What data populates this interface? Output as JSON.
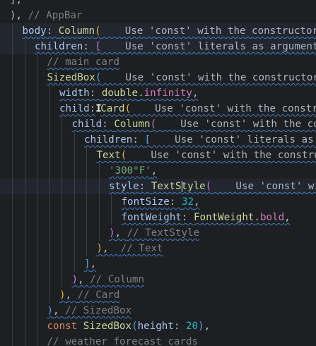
{
  "lines": [
    {
      "indent": 1,
      "hl": false,
      "wavy": false,
      "tokens": [
        [
          "],",
          "k-plain"
        ]
      ]
    },
    {
      "indent": 1,
      "hl": false,
      "wavy": false,
      "tokens": [
        [
          "), ",
          "k-plain"
        ],
        [
          "// AppBar",
          "k-cmt"
        ]
      ]
    },
    {
      "indent": 2,
      "hl": true,
      "wavy": true,
      "tokens": [
        [
          "body",
          "k-prop"
        ],
        [
          ": ",
          "k-plain"
        ],
        [
          "Column",
          "k-class"
        ],
        [
          "(",
          "b1"
        ],
        [
          "    Use 'const' with the constructor",
          "k-hint"
        ]
      ]
    },
    {
      "indent": 3,
      "hl": true,
      "wavy": true,
      "tokens": [
        [
          "children",
          "k-prop"
        ],
        [
          ": ",
          "k-plain"
        ],
        [
          "[",
          "b2"
        ],
        [
          "    Use 'const' literals as arguments",
          "k-hint"
        ]
      ]
    },
    {
      "indent": 4,
      "hl": false,
      "wavy": true,
      "tokens": [
        [
          "// main card",
          "k-cmt"
        ]
      ]
    },
    {
      "indent": 4,
      "hl": false,
      "wavy": true,
      "tokens": [
        [
          "SizedBox",
          "k-class"
        ],
        [
          "(",
          "b3"
        ],
        [
          "    Use 'const' with the constructor",
          "k-hint"
        ]
      ]
    },
    {
      "indent": 5,
      "hl": false,
      "wavy": true,
      "tokens": [
        [
          "width",
          "k-prop"
        ],
        [
          ": ",
          "k-plain"
        ],
        [
          "double",
          "k-class"
        ],
        [
          ".",
          "k-plain"
        ],
        [
          "infinity",
          "k-const"
        ],
        [
          ",",
          "k-plain"
        ]
      ]
    },
    {
      "indent": 5,
      "hl": false,
      "wavy": true,
      "tokens": [
        [
          "child",
          "k-prop"
        ],
        [
          ":",
          "k-plain"
        ],
        [
          "IBEAM",
          "k-plain"
        ],
        [
          "Card",
          "k-class"
        ],
        [
          "(",
          "b1"
        ],
        [
          "    Use 'const' with the constructor",
          "k-hint"
        ]
      ]
    },
    {
      "indent": 6,
      "hl": false,
      "wavy": true,
      "tokens": [
        [
          "child",
          "k-prop"
        ],
        [
          ": ",
          "k-plain"
        ],
        [
          "Column",
          "k-class"
        ],
        [
          "(",
          "b2"
        ],
        [
          "    Use 'const' with the constructor",
          "k-hint"
        ]
      ]
    },
    {
      "indent": 7,
      "hl": false,
      "wavy": true,
      "tokens": [
        [
          "children",
          "k-prop"
        ],
        [
          ": ",
          "k-plain"
        ],
        [
          "[",
          "b3"
        ],
        [
          "    Use 'const' literals as arguments",
          "k-hint"
        ]
      ]
    },
    {
      "indent": 8,
      "hl": false,
      "wavy": true,
      "tokens": [
        [
          "Text",
          "k-class"
        ],
        [
          "(",
          "b1"
        ],
        [
          "    Use 'const' with the constructor",
          "k-hint"
        ]
      ]
    },
    {
      "indent": 9,
      "hl": false,
      "wavy": true,
      "tokens": [
        [
          "'300°F'",
          "k-str"
        ],
        [
          ",",
          "k-plain"
        ]
      ]
    },
    {
      "indent": 9,
      "hl": true,
      "wavy": true,
      "tokens": [
        [
          "style",
          "k-prop"
        ],
        [
          ": ",
          "k-plain"
        ],
        [
          "TextS",
          "k-class"
        ],
        [
          "CARET",
          "k-plain"
        ],
        [
          "tyle",
          "k-class"
        ],
        [
          "(",
          "b2"
        ],
        [
          "    Use 'const' with the constructor",
          "k-hint"
        ]
      ]
    },
    {
      "indent": 10,
      "hl": false,
      "wavy": true,
      "tokens": [
        [
          "fontSize",
          "k-prop"
        ],
        [
          ": ",
          "k-plain"
        ],
        [
          "32",
          "k-num"
        ],
        [
          ",",
          "k-plain"
        ]
      ]
    },
    {
      "indent": 10,
      "hl": false,
      "wavy": true,
      "tokens": [
        [
          "fontWeight",
          "k-prop"
        ],
        [
          ": ",
          "k-plain"
        ],
        [
          "FontWeight",
          "k-class"
        ],
        [
          ".",
          "k-plain"
        ],
        [
          "bold",
          "k-const"
        ],
        [
          ",",
          "k-plain"
        ]
      ]
    },
    {
      "indent": 9,
      "hl": false,
      "wavy": true,
      "tokens": [
        [
          ")",
          "b2"
        ],
        [
          ", ",
          "k-plain"
        ],
        [
          "// TextStyle",
          "k-cmt"
        ]
      ]
    },
    {
      "indent": 8,
      "hl": false,
      "wavy": true,
      "tokens": [
        [
          ")",
          "b1"
        ],
        [
          ",  ",
          "k-plain"
        ],
        [
          "// Text",
          "k-cmt"
        ]
      ]
    },
    {
      "indent": 7,
      "hl": false,
      "wavy": true,
      "tokens": [
        [
          "]",
          "b3"
        ],
        [
          ",",
          "k-plain"
        ]
      ]
    },
    {
      "indent": 6,
      "hl": false,
      "wavy": true,
      "tokens": [
        [
          ")",
          "b2"
        ],
        [
          ", ",
          "k-plain"
        ],
        [
          "// Column",
          "k-cmt"
        ]
      ]
    },
    {
      "indent": 5,
      "hl": false,
      "wavy": true,
      "tokens": [
        [
          ")",
          "b1"
        ],
        [
          ", ",
          "k-plain"
        ],
        [
          "// Card",
          "k-cmt"
        ]
      ]
    },
    {
      "indent": 4,
      "hl": false,
      "wavy": true,
      "tokens": [
        [
          ")",
          "b3"
        ],
        [
          ", ",
          "k-plain"
        ],
        [
          "// SizedBox",
          "k-cmt"
        ]
      ]
    },
    {
      "indent": 4,
      "hl": false,
      "wavy": false,
      "tokens": [
        [
          "const ",
          "k-kw"
        ],
        [
          "SizedBox",
          "k-class"
        ],
        [
          "(",
          "b3"
        ],
        [
          "height",
          "k-prop"
        ],
        [
          ": ",
          "k-plain"
        ],
        [
          "20",
          "k-num"
        ],
        [
          ")",
          "b3"
        ],
        [
          ",",
          "k-plain"
        ]
      ]
    },
    {
      "indent": 4,
      "hl": false,
      "wavy": true,
      "tokens": [
        [
          "// weather forecast cards",
          "k-cmt"
        ]
      ]
    }
  ]
}
